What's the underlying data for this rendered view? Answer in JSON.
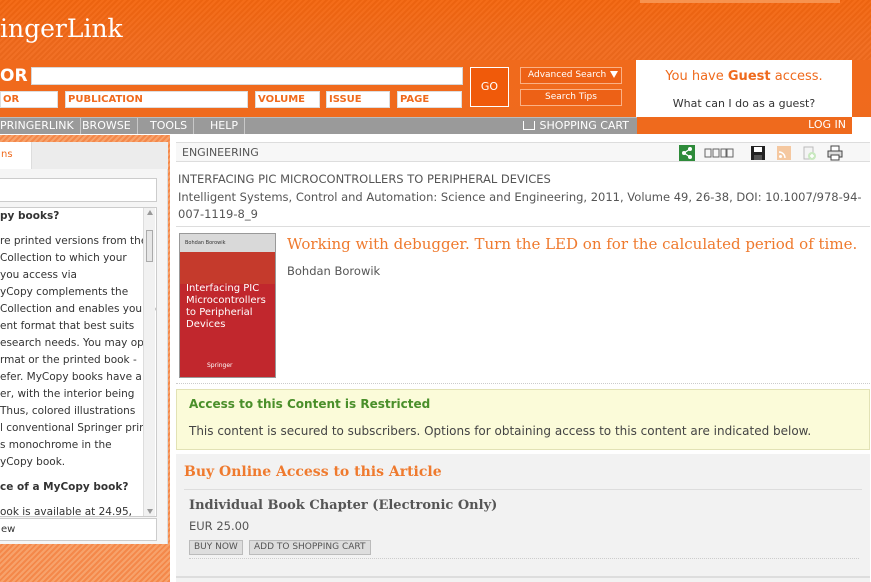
{
  "header": {
    "logo": "ingerLink",
    "for_label": "OR",
    "search_value": "",
    "fields": {
      "author": "OR",
      "publication": "PUBLICATION",
      "volume": "VOLUME",
      "issue": "ISSUE",
      "page": "PAGE"
    },
    "go_label": "GO",
    "advanced_search": "Advanced Search",
    "search_tips": "Search Tips",
    "guest_prefix": "You have ",
    "guest_bold": "Guest",
    "guest_suffix": " access.",
    "guest_question": "What can I do as a guest?"
  },
  "nav": {
    "items": [
      "PRINGERLINK",
      "BROWSE",
      "TOOLS",
      "HELP"
    ],
    "cart": "SHOPPING CART",
    "login": "LOG IN"
  },
  "sidebar": {
    "tab": "ns",
    "question1": "py books?",
    "lines": [
      "re printed versions from the",
      "Collection to which your",
      "you access via",
      "yCopy complements the",
      "Collection and enables you to",
      "ent format that best suits",
      "esearch needs. You may opt",
      "rmat or the printed book -",
      "efer. MyCopy books have a",
      "er, with the interior being",
      " Thus, colored illustrations",
      "l conventional Springer print",
      "s monochrome in the",
      "yCopy book."
    ],
    "question2": "ce of a MyCopy book?",
    "last_line": "ook is available at 24.95,",
    "bottom": "ew"
  },
  "breadcrumb": "ENGINEERING",
  "chapter": {
    "title": "INTERFACING PIC MICROCONTROLLERS TO PERIPHERAL DEVICES",
    "meta": "Intelligent Systems, Control and Automation: Science and Engineering, 2011, Volume 49, 26-38, DOI: 10.1007/978-94-007-1119-8_9"
  },
  "cover": {
    "author": "Bohdan Borowik",
    "title": "Interfacing PIC Microcontrollers to Peripherial Devices",
    "publisher": "Springer"
  },
  "article": {
    "title": "Working with debugger. Turn the LED on for the calculated period of time.",
    "author": "Bohdan Borowik"
  },
  "access": {
    "title": "Access to this Content is Restricted",
    "text": "This content is secured to subscribers. Options for obtaining access to this content are indicated below."
  },
  "buy": {
    "heading": "Buy Online Access to this Article",
    "option": "Individual Book Chapter (Electronic Only)",
    "price": "EUR 25.00",
    "buy_now": "BUY NOW",
    "add_cart": "ADD TO SHOPPING CART"
  },
  "colors": {
    "accent": "#ef6a1d",
    "header": "#f06a1c",
    "nav": "#9a9a9a",
    "restricted_bg": "#fbfbd9",
    "restricted_title": "#4a8f2a"
  }
}
